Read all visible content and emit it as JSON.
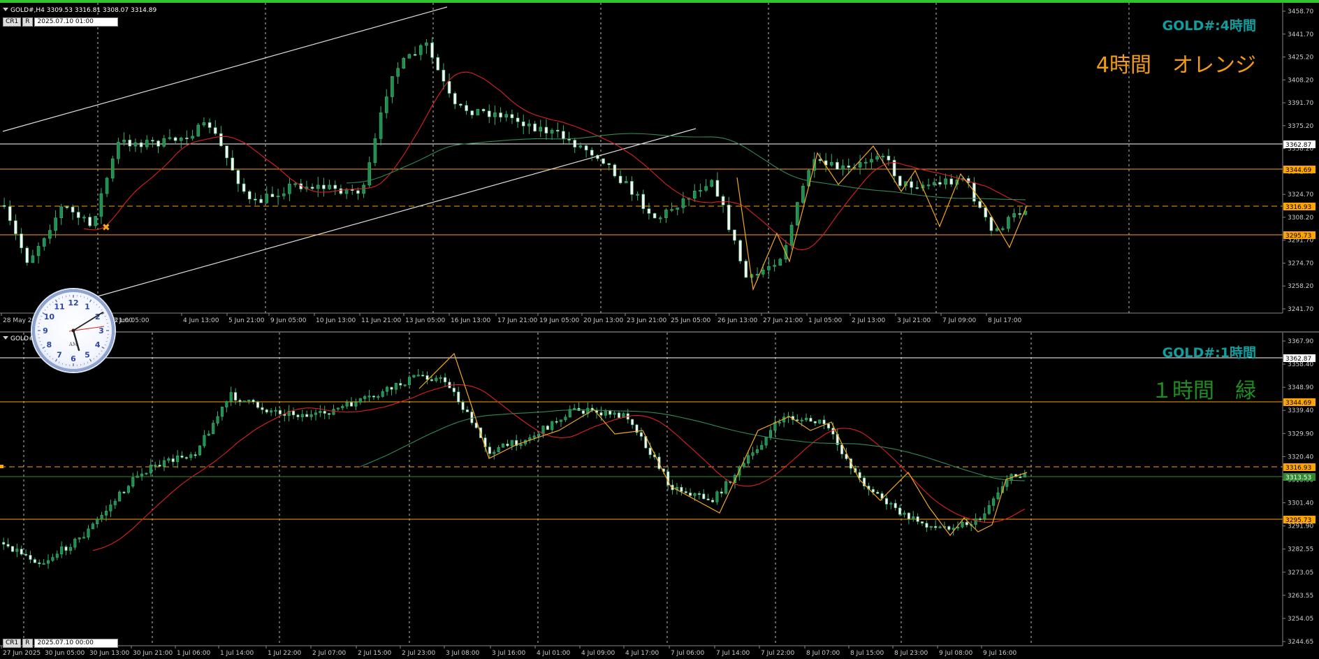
{
  "top_chart": {
    "header_text": "GOLD#,H4  3309.53 3316.81 3308.07 3314.89",
    "cr_label": "CR1",
    "r_label": "R",
    "datetime": "2025.07.10 01:00",
    "symbol_label": "GOLD#:4時間",
    "annotation": "4時間　オレンジ",
    "annotation_color": "#f39c12",
    "symbol_color": "#0f9f9f",
    "price_labels": [
      "3458.70",
      "3441.70",
      "3425.20",
      "3408.20",
      "3391.70",
      "3375.20",
      "3358.20",
      "3341.70",
      "3324.70",
      "3308.20",
      "3291.70",
      "3274.70",
      "3258.20",
      "3241.70"
    ],
    "highlight_prices": [
      {
        "value": "3362.87",
        "color": "#ffffff"
      },
      {
        "value": "3344.69",
        "color": "#ffa500"
      },
      {
        "value": "3316.93",
        "color": "#ffa500"
      },
      {
        "value": "3295.73",
        "color": "#ffa500"
      }
    ],
    "time_labels": [
      "28 May 20",
      "3 Jun 05:00",
      "4 Jun 13:00",
      "5 Jun 21:00",
      "9 Jun 05:00",
      "10 Jun 13:00",
      "11 Jun 21:00",
      "13 Jun 05:00",
      "16 Jun 13:00",
      "17 Jun 21:00",
      "19 Jun 05:00",
      "20 Jun 13:00",
      "23 Jun 21:00",
      "25 Jun 05:00",
      "26 Jun 13:00",
      "27 Jun 21:00",
      "1 Jul 05:00",
      "2 Jul 13:00",
      "3 Jul 21:00",
      "7 Jul 09:00",
      "8 Jul 17:00"
    ],
    "time_label_partial": "21:00"
  },
  "bottom_chart": {
    "header_text": "GOLD#,H1  3314.48 3314.90",
    "cr_label": "CR1",
    "r_label": "R",
    "datetime": "2025.07.10 00:00",
    "symbol_label": "GOLD#:1時間",
    "annotation": "１時間　緑",
    "annotation_color": "#1e8f1e",
    "symbol_color": "#0f9f9f",
    "price_labels": [
      "3367.90",
      "3358.40",
      "3348.90",
      "3339.40",
      "3329.90",
      "3320.40",
      "3310.90",
      "3301.40",
      "3291.90",
      "3282.55",
      "3273.05",
      "3263.55",
      "3254.05",
      "3244.65"
    ],
    "highlight_prices": [
      {
        "value": "3362.87",
        "color": "#ffffff"
      },
      {
        "value": "3344.69",
        "color": "#ffa500"
      },
      {
        "value": "3316.93",
        "color": "#ffa500"
      },
      {
        "value": "3313.53",
        "color": "#2e8b2e"
      },
      {
        "value": "3295.73",
        "color": "#ffa500"
      }
    ],
    "time_labels": [
      "27 Jun 2025",
      "30 Jun 05:00",
      "30 Jun 13:00",
      "30 Jun 21:00",
      "1 Jul 06:00",
      "1 Jul 14:00",
      "1 Jul 22:00",
      "2 Jul 07:00",
      "2 Jul 15:00",
      "2 Jul 23:00",
      "3 Jul 08:00",
      "3 Jul 16:00",
      "4 Jul 01:00",
      "4 Jul 09:00",
      "4 Jul 17:00",
      "7 Jul 06:00",
      "7 Jul 14:00",
      "7 Jul 22:00",
      "8 Jul 07:00",
      "8 Jul 15:00",
      "8 Jul 23:00",
      "9 Jul 08:00",
      "9 Jul 16:00"
    ]
  },
  "clock": {
    "numerals": [
      "12",
      "1",
      "2",
      "3",
      "4",
      "5",
      "6",
      "7",
      "8",
      "9",
      "10",
      "11"
    ],
    "am_label": "AM"
  }
}
